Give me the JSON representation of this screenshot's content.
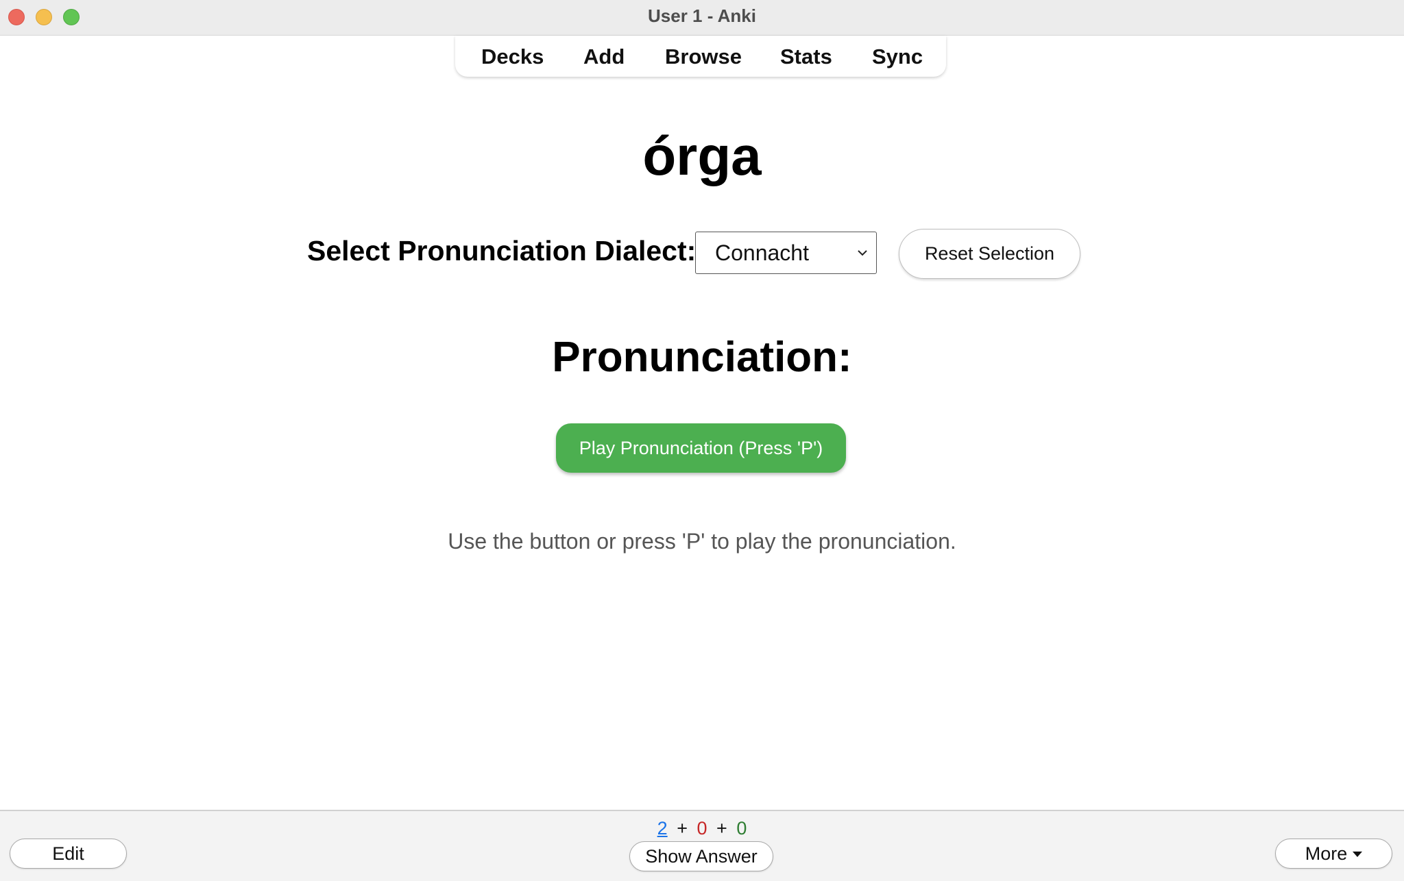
{
  "window": {
    "title": "User 1 - Anki"
  },
  "toolbar": {
    "items": [
      "Decks",
      "Add",
      "Browse",
      "Stats",
      "Sync"
    ]
  },
  "card": {
    "word": "órga",
    "dialect_label": "Select Pronunciation Dialect:",
    "dialect_selected": "Connacht",
    "reset_label": "Reset Selection",
    "pronunciation_heading": "Pronunciation:",
    "play_label": "Play Pronunciation (Press 'P')",
    "hint": "Use the button or press 'P' to play the pronunciation."
  },
  "bottombar": {
    "edit_label": "Edit",
    "show_answer_label": "Show Answer",
    "more_label": "More",
    "counts": {
      "new": "2",
      "learning": "0",
      "review": "0",
      "separator": "+"
    }
  },
  "colors": {
    "play_button": "#4caf50",
    "count_new": "#1a73e8",
    "count_learning": "#c62828",
    "count_review": "#2e7d32",
    "traffic_close": "#ed6a5e",
    "traffic_minimize": "#f5bf4f",
    "traffic_zoom": "#61c554"
  },
  "icons": {
    "select_chevron": "chevron-down-icon",
    "more_caret": "caret-down-icon"
  }
}
